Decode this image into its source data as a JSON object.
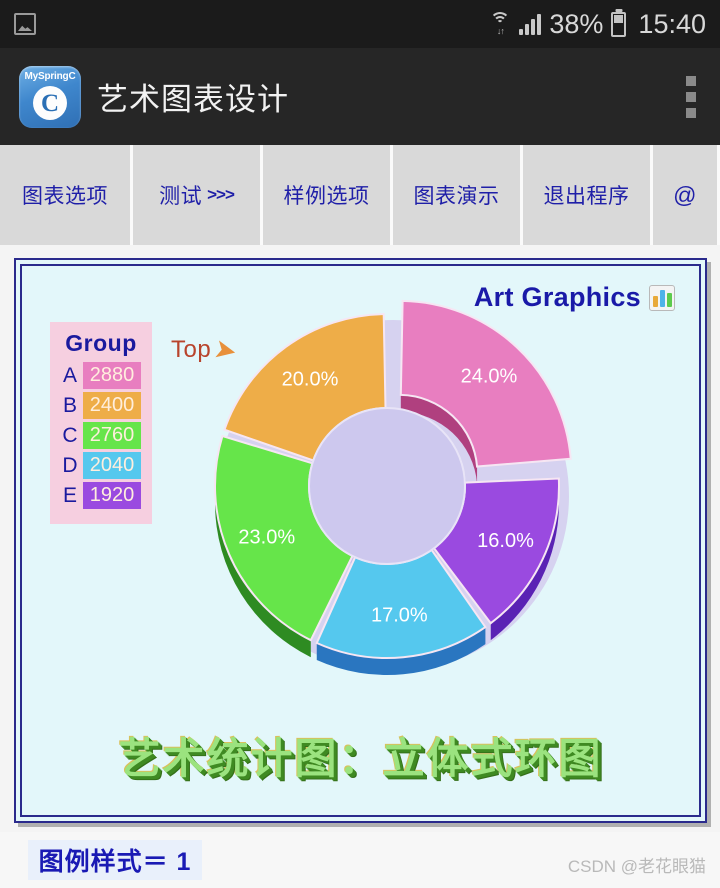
{
  "status_bar": {
    "gallery_icon": "image-icon",
    "wifi_icon": "wifi-icon",
    "signal_icon": "cell-signal-icon",
    "battery_percent": "38%",
    "battery_icon": "battery-icon",
    "clock": "15:40"
  },
  "app_bar": {
    "app_icon_label": "MySpringC",
    "app_icon_letter": "C",
    "title": "艺术图表设计",
    "overflow_icon": "overflow-menu-icon"
  },
  "menu": {
    "items": [
      {
        "label": "图表选项",
        "arrows": ""
      },
      {
        "label": "测试",
        "arrows": ">>>"
      },
      {
        "label": "样例选项",
        "arrows": ""
      },
      {
        "label": "图表演示",
        "arrows": ""
      },
      {
        "label": "退出程序",
        "arrows": ""
      },
      {
        "label": "@",
        "arrows": ""
      }
    ]
  },
  "chart_panel": {
    "art_title": "Art Graphics",
    "art_title_icon": "bar-chart-icon",
    "top_annotation": {
      "text": "Top",
      "arrow_icon": "arrow-down-right-icon"
    },
    "caption": "艺术统计图：立体式环图",
    "legend_title": "Group"
  },
  "bottom_bar": {
    "legend_style_label": "图例样式＝ 1",
    "watermark": "CSDN @老花眼猫"
  },
  "chart_data": {
    "type": "pie",
    "variant": "3d-exploded-donut",
    "title": "艺术统计图：立体式环图",
    "categories": [
      "A",
      "B",
      "C",
      "D",
      "E"
    ],
    "values": [
      2880,
      2400,
      2760,
      2040,
      1920
    ],
    "percent_labels": [
      "24.0%",
      "20.0%",
      "23.0%",
      "17.0%",
      "16.0%"
    ],
    "colors": [
      "#e87ec0",
      "#eead48",
      "#66e54a",
      "#55c8ee",
      "#9a4ae0"
    ],
    "side_colors": [
      "#b0407f",
      "#c07a19",
      "#2e8b22",
      "#2a76c0",
      "#5a22b4"
    ],
    "hole_color": "#cdc8ee",
    "legend_value_text_color": "#ffeedd",
    "exploded_index": 0,
    "start_angle_deg": -90,
    "direction": "clockwise",
    "slices": [
      {
        "key": "A",
        "value": 2880,
        "percent": 24.0,
        "label": "24.0%",
        "color": "#e87ec0",
        "exploded": true
      },
      {
        "key": "E",
        "value": 1920,
        "percent": 16.0,
        "label": "16.0%",
        "color": "#9a4ae0",
        "exploded": false
      },
      {
        "key": "D",
        "value": 2040,
        "percent": 17.0,
        "label": "17.0%",
        "color": "#55c8ee",
        "exploded": false
      },
      {
        "key": "C",
        "value": 2760,
        "percent": 23.0,
        "label": "23.0%",
        "color": "#66e54a",
        "exploded": false
      },
      {
        "key": "B",
        "value": 2400,
        "percent": 20.0,
        "label": "20.0%",
        "color": "#eead48",
        "exploded": false
      }
    ],
    "legend_rows": [
      {
        "key": "A",
        "value": "2880",
        "color": "#e87ec0"
      },
      {
        "key": "B",
        "value": "2400",
        "color": "#eead48"
      },
      {
        "key": "C",
        "value": "2760",
        "color": "#66e54a"
      },
      {
        "key": "D",
        "value": "2040",
        "color": "#55c8ee"
      },
      {
        "key": "E",
        "value": "1920",
        "color": "#9a4ae0"
      }
    ]
  }
}
